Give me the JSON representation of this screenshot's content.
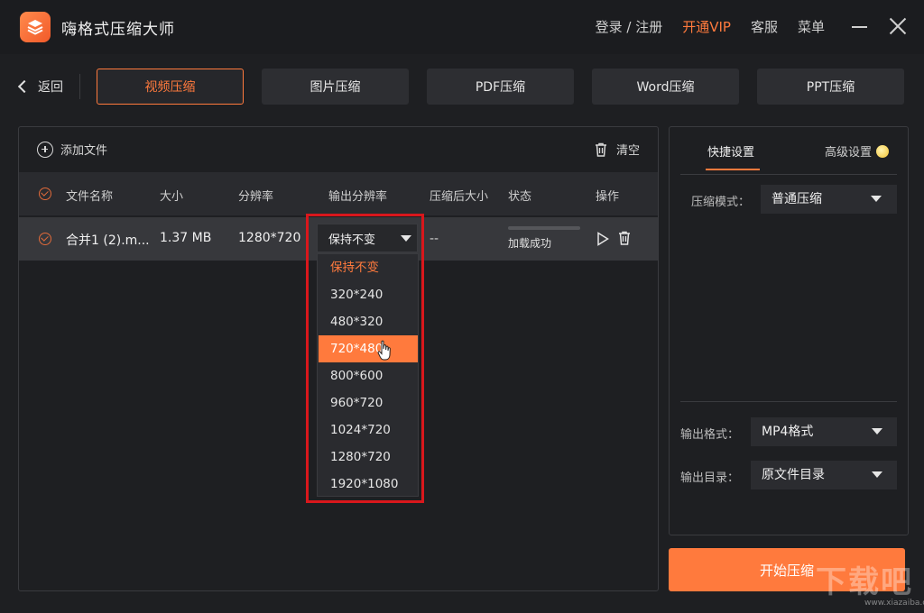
{
  "app": {
    "title": "嗨格式压缩大师"
  },
  "topnav": {
    "login": "登录 / 注册",
    "vip": "开通VIP",
    "service": "客服",
    "menu": "菜单"
  },
  "nav": {
    "back": "返回",
    "tabs": [
      "视频压缩",
      "图片压缩",
      "PDF压缩",
      "Word压缩",
      "PPT压缩"
    ],
    "active_tab": 0
  },
  "toolbar": {
    "add_file": "添加文件",
    "clear": "清空"
  },
  "table": {
    "headers": [
      "文件名称",
      "大小",
      "分辨率",
      "输出分辨率",
      "压缩后大小",
      "状态",
      "操作"
    ],
    "rows": [
      {
        "name": "合并1 (2).m...",
        "size": "1.37 MB",
        "resolution": "1280*720",
        "output_resolution": "保持不变",
        "compressed_size": "--",
        "status": "加载成功",
        "progress": 0
      }
    ]
  },
  "resolution_dropdown": {
    "options": [
      "保持不变",
      "320*240",
      "480*320",
      "720*480",
      "800*600",
      "960*720",
      "1024*720",
      "1280*720",
      "1920*1080"
    ],
    "selected_index": 0,
    "hovered_index": 3
  },
  "settings": {
    "tabs": {
      "quick": "快捷设置",
      "advanced": "高级设置"
    },
    "mode_label": "压缩模式：",
    "mode_value": "普通压缩",
    "format_label": "输出格式：",
    "format_value": "MP4格式",
    "dir_label": "输出目录：",
    "dir_value": "原文件目录"
  },
  "start_button": "开始压缩",
  "watermark": {
    "main": "下载吧",
    "sub": "www.xiazaiba.com"
  },
  "colors": {
    "accent": "#ff7a3d",
    "highlight": "#d9171c",
    "background": "#1e1f22"
  }
}
